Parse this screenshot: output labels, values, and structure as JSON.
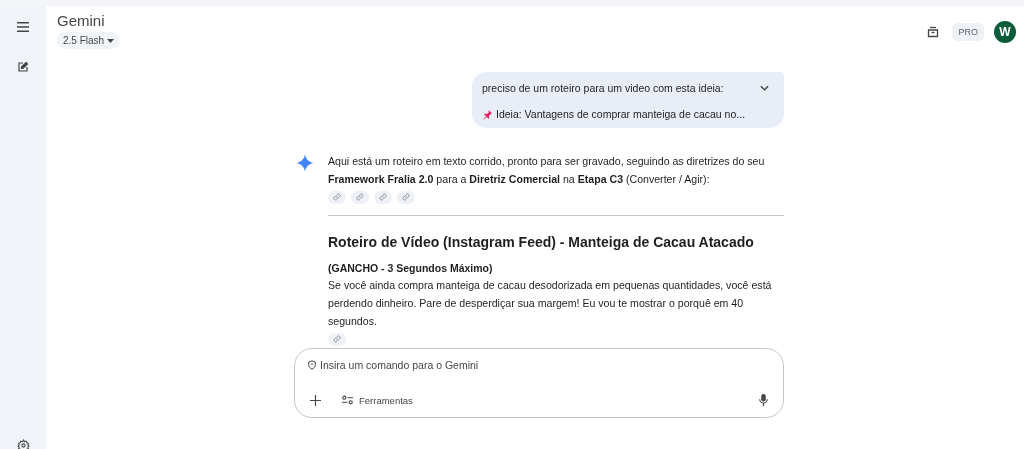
{
  "header": {
    "title": "Gemini",
    "model": "2.5 Flash",
    "plan_badge": "PRO",
    "avatar": "W"
  },
  "user_message": {
    "lines": [
      "preciso de um roteiro para um video com esta ideia:",
      "Ideia: Vantagens de comprar manteiga de cacau no..."
    ],
    "expanded": false
  },
  "response": {
    "intro": "Aqui está um roteiro em texto corrido, pronto para ser gravado, seguindo as diretrizes do seu **Framework Fralia 2.0** para a **Diretriz Comercial** na **Etapa C3** (Converter / Agir):",
    "intro_citations": [
      {
        "kind": "link"
      },
      {
        "kind": "link"
      },
      {
        "kind": "link"
      },
      {
        "kind": "link"
      }
    ],
    "heading": "Roteiro de Vídeo (Instagram Feed) - Manteiga de Cacau Atacado",
    "section_title": "(GANCHO - 3 Segundos Máximo)",
    "section_text": "Se você ainda compra manteiga de cacau desodorizada em pequenas quantidades, você está perdendo dinheiro. Pare de desperdiçar sua margem! Eu vou te mostrar o porquê em 40 segundos.",
    "section_citations": [
      {
        "kind": "link"
      }
    ]
  },
  "composer": {
    "placeholder": "Insira um comando para o Gemini",
    "tools_label": "Ferramentas"
  }
}
